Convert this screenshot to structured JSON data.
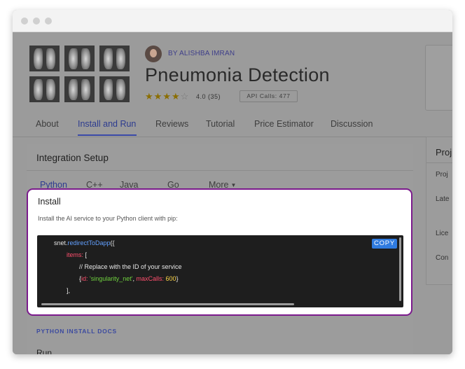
{
  "header": {
    "author": "BY ALISHBA IMRAN",
    "title": "Pneumonia Detection",
    "rating_text": "4.0 (35)",
    "stars_filled": 4,
    "stars_total": 5,
    "api_calls": "API Calls: 477"
  },
  "tabs": [
    {
      "label": "About"
    },
    {
      "label": "Install and Run"
    },
    {
      "label": "Reviews"
    },
    {
      "label": "Tutorial"
    },
    {
      "label": "Price Estimator"
    },
    {
      "label": "Discussion"
    }
  ],
  "integration": {
    "heading": "Integration Setup",
    "languages": [
      {
        "label": "Python"
      },
      {
        "label": "C++"
      },
      {
        "label": "Java"
      },
      {
        "label": "Go"
      },
      {
        "label": "More"
      }
    ],
    "docs_link": "PYTHON INSTALL DOCS",
    "run_heading": "Run"
  },
  "install": {
    "heading": "Install",
    "description": "Install the AI service to your Python client with pip:",
    "copy_label": "COPY",
    "code": {
      "l1_obj": "snet.",
      "l1_fn": "redirectToDapp",
      "l1_end": "({",
      "l2_key": "items:",
      "l2_end": " [",
      "l3": "// Replace with the ID of your service",
      "l4_open": "{",
      "l4_id_key": "id:",
      "l4_id_val": " 'singularity_net'",
      "l4_comma": ", ",
      "l4_max_key": "maxCalls:",
      "l4_max_val": " 600",
      "l4_close": "}",
      "l5": "],"
    }
  },
  "side_panel": {
    "title": "Proj",
    "items": [
      "Proj",
      "Late",
      "Lice",
      "Con"
    ]
  },
  "colors": {
    "accent": "#3a4aa8",
    "highlight_border": "#7b1a8c",
    "copy_button": "#2f7be0"
  }
}
